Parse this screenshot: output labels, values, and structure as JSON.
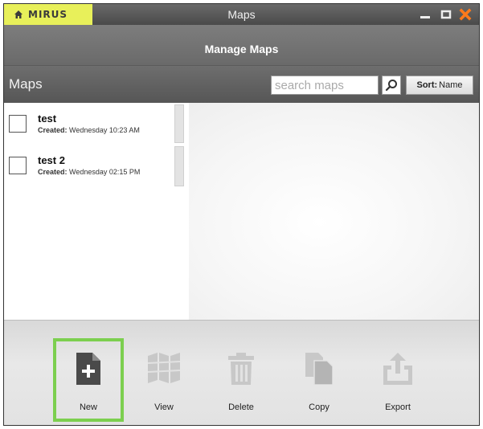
{
  "window": {
    "brand": "MIRUS",
    "title": "Maps",
    "brand_color": "#e8f05a",
    "close_color": "#ff7a1a"
  },
  "header": {
    "title": "Manage Maps"
  },
  "toolbar": {
    "label": "Maps",
    "search_placeholder": "search maps",
    "search_icon": "search-icon",
    "sort_prefix": "Sort:",
    "sort_value": "Name"
  },
  "maps": [
    {
      "name": "test",
      "created_label": "Created:",
      "created_value": "Wednesday 10:23 AM"
    },
    {
      "name": "test 2",
      "created_label": "Created:",
      "created_value": "Wednesday 02:15 PM"
    }
  ],
  "actions": [
    {
      "label": "New",
      "icon": "new-file-icon",
      "selected": true
    },
    {
      "label": "View",
      "icon": "map-icon",
      "selected": false
    },
    {
      "label": "Delete",
      "icon": "trash-icon",
      "selected": false
    },
    {
      "label": "Copy",
      "icon": "copy-icon",
      "selected": false
    },
    {
      "label": "Export",
      "icon": "export-icon",
      "selected": false
    }
  ],
  "colors": {
    "selection_outline": "#7ccf4f",
    "icon_active": "#4a4a4a",
    "icon_disabled": "#c8c8c8"
  }
}
